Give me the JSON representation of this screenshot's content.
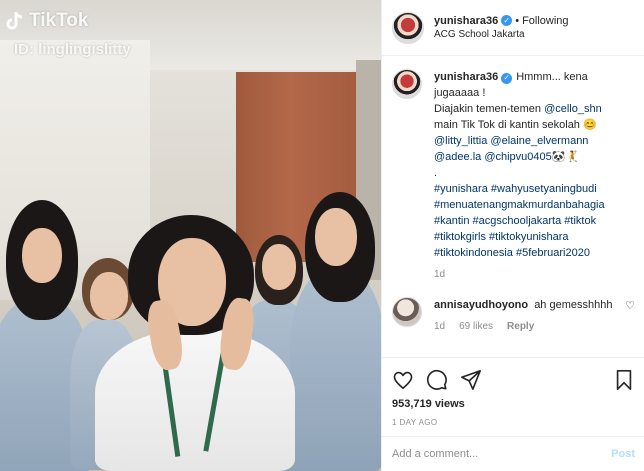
{
  "media": {
    "watermark_brand": "TikTok",
    "watermark_id": "ID: linglingislitty"
  },
  "header": {
    "username": "yunishara36",
    "separator": "•",
    "follow_status": "Following",
    "location": "ACG School Jakarta"
  },
  "caption": {
    "username": "yunishara36",
    "line1": "Hmmm... kena jugaaaaa !",
    "line2_prefix": "Diajakin temen-temen ",
    "mention1": "@cello_shn",
    "line3": "main Tik Tok di kantin sekolah 😊",
    "mention2": "@litty_littia",
    "mention3": "@elaine_elvermann",
    "mention4": "@adee.la",
    "mention5": "@chipvu0405",
    "emoji_tail": "🐼🤾",
    "dot": ".",
    "hashtags": [
      "#yunishara",
      "#wahyusetyaningbudi",
      "#menuatenangmakmurdanbahagia",
      "#kantin",
      "#acgschooljakarta",
      "#tiktok",
      "#tiktokgirls",
      "#tiktokyunishara",
      "#tiktokindonesia",
      "#5februari2020"
    ],
    "time": "1d"
  },
  "comment": {
    "username": "annisayudhoyono",
    "text": "ah gemesshhhh",
    "time": "1d",
    "likes": "69 likes",
    "reply": "Reply"
  },
  "actions": {
    "icons": [
      "heart-icon",
      "comment-icon",
      "share-icon",
      "bookmark-icon"
    ],
    "views": "953,719 views",
    "posted": "1 DAY AGO"
  },
  "add_comment": {
    "placeholder": "Add a comment...",
    "post_label": "Post"
  },
  "colors": {
    "link": "#003569",
    "verified": "#3897f0",
    "post_disabled": "#b2dffc",
    "muted": "#8e8e8e"
  }
}
